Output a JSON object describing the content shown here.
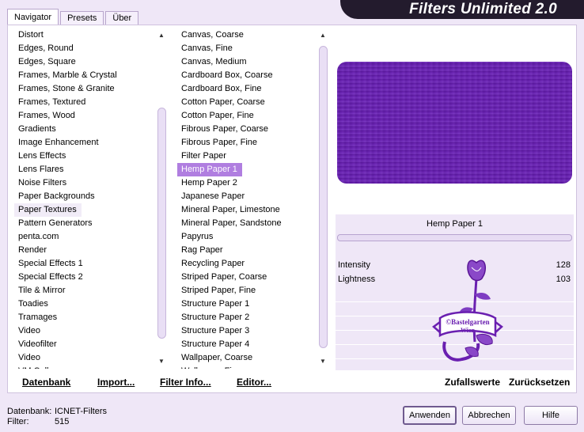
{
  "app": {
    "title": "Filters Unlimited 2.0"
  },
  "tabs": [
    {
      "label": "Navigator",
      "active": true
    },
    {
      "label": "Presets",
      "active": false
    },
    {
      "label": "Über",
      "active": false
    }
  ],
  "categories": {
    "items": [
      "Distort",
      "Edges, Round",
      "Edges, Square",
      "Frames, Marble & Crystal",
      "Frames, Stone & Granite",
      "Frames, Textured",
      "Frames, Wood",
      "Gradients",
      "Image Enhancement",
      "Lens Effects",
      "Lens Flares",
      "Noise Filters",
      "Paper Backgrounds",
      "Paper Textures",
      "Pattern Generators",
      "penta.com",
      "Render",
      "Special Effects 1",
      "Special Effects 2",
      "Tile & Mirror",
      "Toadies",
      "Tramages",
      "Video",
      "Videofilter",
      "Video",
      "VM Colle..."
    ],
    "highlighted": "Paper Textures"
  },
  "filters": {
    "items": [
      "Canvas, Coarse",
      "Canvas, Fine",
      "Canvas, Medium",
      "Cardboard Box, Coarse",
      "Cardboard Box, Fine",
      "Cotton Paper, Coarse",
      "Cotton Paper, Fine",
      "Fibrous Paper, Coarse",
      "Fibrous Paper, Fine",
      "Filter Paper",
      "Hemp Paper 1",
      "Hemp Paper 2",
      "Japanese Paper",
      "Mineral Paper, Limestone",
      "Mineral Paper, Sandstone",
      "Papyrus",
      "Rag Paper",
      "Recycling Paper",
      "Striped Paper, Coarse",
      "Striped Paper, Fine",
      "Structure Paper 1",
      "Structure Paper 2",
      "Structure Paper 3",
      "Structure Paper 4",
      "Wallpaper, Coarse",
      "Wallpaper, Fine"
    ],
    "selected": "Hemp Paper 1"
  },
  "preview": {
    "color": "#6a22b5",
    "filter_name": "Hemp Paper 1"
  },
  "params": [
    {
      "label": "Intensity",
      "value": "128"
    },
    {
      "label": "Lightness",
      "value": "103"
    }
  ],
  "watermark": {
    "line1": "©Bastelgarten",
    "line2": "Wien"
  },
  "links": {
    "datenbank": "Datenbank",
    "import": "Import...",
    "filter_info": "Filter Info...",
    "editor": "Editor...",
    "zufallswerte": "Zufallswerte",
    "zuruecksetzen": "Zurücksetzen"
  },
  "status": {
    "db_label": "Datenbank:",
    "db_value": "ICNET-Filters",
    "filter_label": "Filter:",
    "filter_value": "515"
  },
  "buttons": {
    "apply": "Anwenden",
    "cancel": "Abbrechen",
    "help": "Hilfe"
  }
}
